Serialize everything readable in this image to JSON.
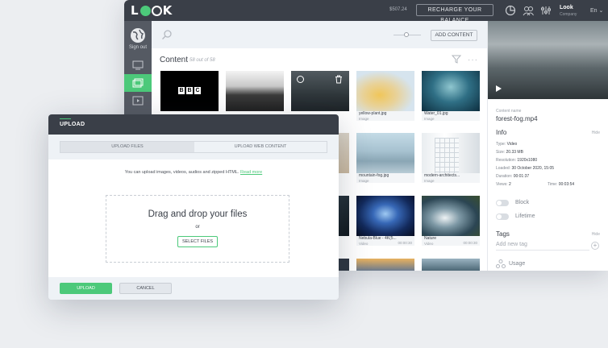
{
  "app": {
    "logo": "LOOK",
    "balance": "$507.24",
    "recharge_label": "RECHARGE YOUR BALANCE",
    "user_name": "Look",
    "user_company": "Company",
    "language": "En",
    "signout_label": "Sign out",
    "brand_color": "#4cc97a",
    "dark_color": "#3a3f48"
  },
  "toolbar": {
    "add_content_label": "ADD CONTENT"
  },
  "content": {
    "title": "Content",
    "count": "58 out of 58",
    "items": [
      {
        "name": "",
        "type": "",
        "size": ""
      },
      {
        "name": "",
        "type": "",
        "size": ""
      },
      {
        "name": "",
        "type": "",
        "size": ""
      },
      {
        "name": "yellow-plant.jpg",
        "type": "Image",
        "size": ""
      },
      {
        "name": "Water_01.jpg",
        "type": "Image",
        "size": ""
      },
      {
        "name": "",
        "type": "",
        "size": ""
      },
      {
        "name": "mountain-fog.jpg",
        "type": "Image",
        "size": ""
      },
      {
        "name": "modern-architects...",
        "type": "Image",
        "size": ""
      },
      {
        "name": "",
        "type": "",
        "size": ""
      },
      {
        "name": "Nebula-Blue - 4K(5...",
        "type": "Video",
        "size": "00:00:30"
      },
      {
        "name": "Nature",
        "type": "Video",
        "size": "00:00:30"
      }
    ]
  },
  "details": {
    "name_label": "Content name",
    "file_name": "forest-fog.mp4",
    "info_title": "Info",
    "hide_label": "Hide",
    "type_label": "Type:",
    "type_value": "Video",
    "size_label": "Size:",
    "size_value": "20.33 MB",
    "resolution_label": "Resolution:",
    "resolution_value": "1920x1080",
    "loaded_label": "Loaded:",
    "loaded_value": "30 October 2020, 15:05",
    "duration_label": "Duration:",
    "duration_value": "00:01:37",
    "views_label": "Views:",
    "views_value": "2",
    "time_label": "Time:",
    "time_value": "00:03:54",
    "block_label": "Block",
    "lifetime_label": "Lifetime",
    "tags_title": "Tags",
    "tags_hide": "Hide",
    "tag_placeholder": "Add new tag",
    "usage_label": "Usage"
  },
  "dialog": {
    "title": "UPLOAD",
    "tab_files": "UPLOAD FILES",
    "tab_web": "UPLOAD WEB CONTENT",
    "info_text": "You can upload images, videos, audios and zipped HTML.",
    "read_more": "Read more",
    "drop_title": "Drag and drop your files",
    "drop_or": "or",
    "select_files": "SELECT FILES",
    "upload_button": "UPLOAD",
    "cancel_button": "CANCEL"
  }
}
